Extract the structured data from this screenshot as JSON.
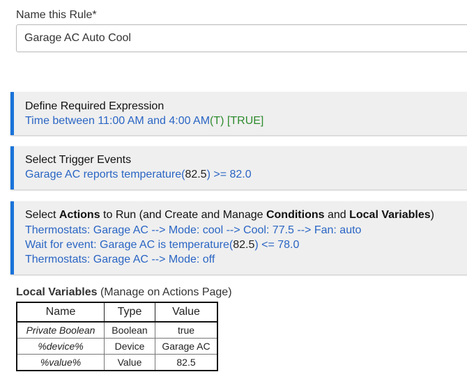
{
  "rule_name": {
    "label": "Name this Rule*",
    "value": "Garage AC Auto Cool"
  },
  "required_expression": {
    "title": "Define Required Expression",
    "text": "Time between 11:00 AM and 4:00 AM",
    "state": "(T) [TRUE]"
  },
  "trigger_events": {
    "title": "Select Trigger Events",
    "prefix": "Garage AC reports temperature(",
    "value": "82.5",
    "suffix": ") >= 82.0"
  },
  "actions": {
    "title_pre": "Select ",
    "title_actions": "Actions",
    "title_mid1": " to Run (and Create and Manage ",
    "title_conditions": "Conditions",
    "title_mid2": " and ",
    "title_local_vars": "Local Variables",
    "title_end": ")",
    "line1": "Thermostats: Garage AC --> Mode: cool --> Cool: 77.5 --> Fan: auto",
    "line2_prefix": "Wait for event: Garage AC is temperature(",
    "line2_value": "82.5",
    "line2_suffix": ") <= 78.0",
    "line3": "Thermostats: Garage AC --> Mode: off"
  },
  "local_variables": {
    "heading": "Local Variables",
    "subheading": " (Manage on Actions Page)",
    "columns": [
      "Name",
      "Type",
      "Value"
    ],
    "rows": [
      {
        "name": "Private Boolean",
        "type": "Boolean",
        "value": "true"
      },
      {
        "name": "%device%",
        "type": "Device",
        "value": "Garage AC"
      },
      {
        "name": "%value%",
        "type": "Value",
        "value": "82.5"
      }
    ]
  },
  "colors": {
    "accent": "#1a73d9",
    "link_text": "#2a65c4",
    "true_text": "#2e8b2e",
    "panel_bg": "#efefef"
  }
}
